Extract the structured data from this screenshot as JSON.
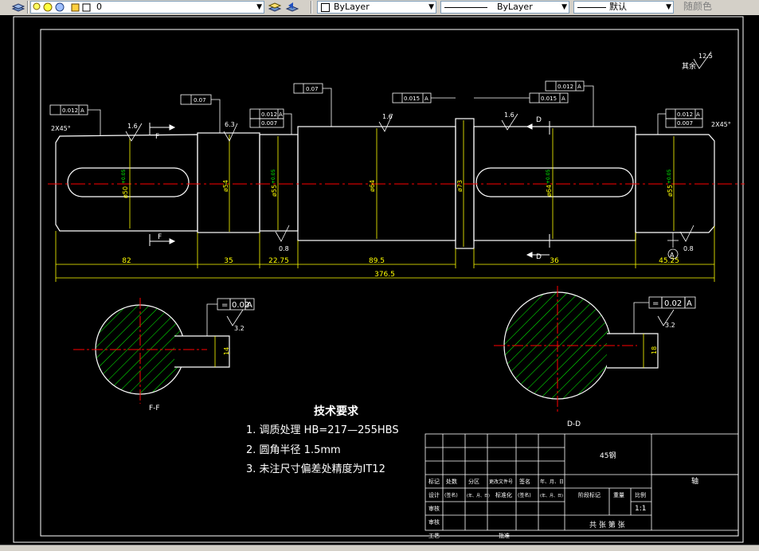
{
  "toolbar": {
    "layer_value": "0",
    "color_value": "ByLayer",
    "linetype_value": "ByLayer",
    "lineweight_value": "默认",
    "plotstyle_value": "随颜色"
  },
  "dims": {
    "d82": "82",
    "d35": "35",
    "d2275": "22.75",
    "d895": "89.5",
    "d36": "36",
    "d4525": "45.25",
    "d3765": "376.5",
    "chamfer_l": "2X45°",
    "chamfer_r": "2X45°",
    "dia50": "ø50",
    "dia54": "ø54",
    "dia55a": "ø55",
    "dia64": "ø64",
    "dia73": "ø73",
    "dia64b": "ø64",
    "dia55b": "ø55",
    "key14": "14",
    "key18": "18"
  },
  "gdt": {
    "v0012": "0.012",
    "v007": "0.07",
    "v0007": "0.007",
    "v0015": "0.015",
    "datum_a": "A",
    "sym_perp": "⊥",
    "sym_flat": "=",
    "v002": "0.02"
  },
  "rough": {
    "r16": "1.6",
    "r63": "6.3",
    "r08": "0.8",
    "r32": "3.2",
    "r125": "12.5",
    "rest": "其余"
  },
  "sections": {
    "f_arrow": "F",
    "d_arrow": "D",
    "f_label": "F-F",
    "d_label": "D-D"
  },
  "tech": {
    "title": "技术要求",
    "line1": "1. 调质处理 HB=217—255HBS",
    "line2": "2. 圆角半径  1.5mm",
    "line3": "3. 未注尺寸偏差处精度为IT12"
  },
  "title_block": {
    "material": "45钢",
    "part_name": "轴",
    "scale": "1:1",
    "sheets": "共 张 第 张",
    "row_marks": [
      "标记",
      "处数",
      "分区",
      "更改文件号",
      "签名",
      "年、月、日"
    ],
    "row_design": [
      "设计",
      "(签名)",
      "(年、月、日)",
      "标准化",
      "(签名)",
      "(年、月、日)"
    ],
    "stage_mark": "阶段标记",
    "weight": "重量",
    "scale_label": "比例",
    "check": "审核",
    "process": "工艺",
    "approve": "批准",
    "review": "审核"
  },
  "colors": {
    "yellow": "#ffff00",
    "white": "#ffffff",
    "red": "#ff0000",
    "green": "#00ff00",
    "bg": "#000000"
  }
}
